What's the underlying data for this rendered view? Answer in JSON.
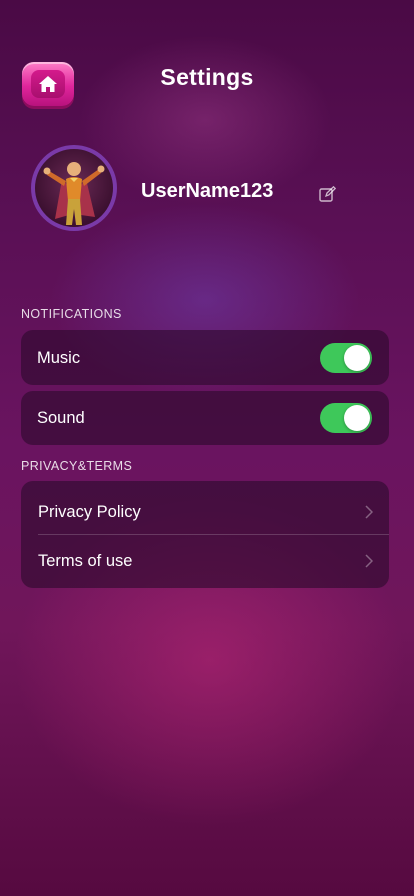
{
  "header": {
    "title": "Settings",
    "home_icon": "home-icon"
  },
  "profile": {
    "username": "UserName123",
    "edit_icon": "edit-icon"
  },
  "notifications": {
    "label": "NOTIFICATIONS",
    "items": [
      {
        "label": "Music",
        "enabled": true
      },
      {
        "label": "Sound",
        "enabled": true
      }
    ]
  },
  "privacy": {
    "label": "PRIVACY&TERMS",
    "items": [
      {
        "label": "Privacy Policy"
      },
      {
        "label": "Terms of use"
      }
    ]
  },
  "colors": {
    "toggle_on": "#3ec85a",
    "home_button": "#e0259c",
    "avatar_ring": "#7a3aa8"
  }
}
